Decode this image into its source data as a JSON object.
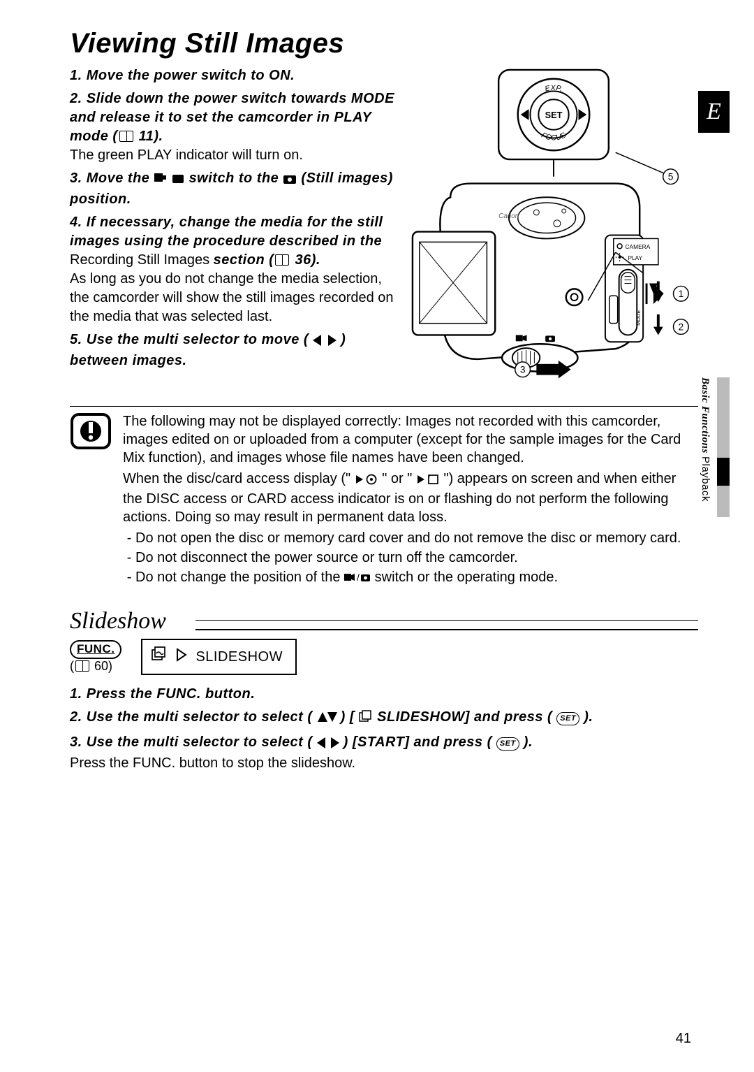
{
  "page": {
    "title": "Viewing Still Images",
    "number": "41",
    "lang_tab": "E",
    "side_section": "Basic Functions",
    "side_sub": "Playback"
  },
  "steps": [
    {
      "n": "1",
      "lead": "Move the power switch to ON."
    },
    {
      "n": "2",
      "lead_a": "Slide down the power switch towards MODE and release it to set the camcorder in PLAY mode (",
      "lead_b": "11).",
      "plain": "The green PLAY indicator will turn on."
    },
    {
      "n": "3",
      "lead_a": "Move the ",
      "lead_b": " switch to the ",
      "lead_c": " (Still images) position."
    },
    {
      "n": "4",
      "lead_a": "If necessary, change the media for the still images using the procedure described in the ",
      "link": "Recording Still Images",
      "lead_b": " section (",
      "lead_c": "36).",
      "plain": "As long as you do not change the media selection, the camcorder will show the still images recorded on the media that was selected last."
    },
    {
      "n": "5",
      "lead_a": "Use the multi selector to move (",
      "lead_b": ") between images."
    }
  ],
  "caution": {
    "p1a": "The following may not be displayed correctly: Images not recorded with this camcorder, images edited on or uploaded from a computer (except for the sample images for the Card Mix function), and images whose file names have been changed.",
    "p2a": "When the disc/card access display (\"",
    "p2b": "\" or \"",
    "p2c": "\") appears on screen and when either the DISC access or CARD access indicator is on or flashing do not perform the following actions. Doing so may result in permanent data loss.",
    "li1": "Do not open the disc or memory card cover and do not remove the disc or memory card.",
    "li2": "Do not disconnect the power source or turn off the camcorder.",
    "li3a": "Do not change the position of the ",
    "li3b": " switch or the operating mode."
  },
  "slideshow": {
    "heading": "Slideshow",
    "func_label": "FUNC.",
    "func_ref": "60",
    "box_label": "SLIDESHOW",
    "steps": [
      {
        "n": "1",
        "lead": "Press the FUNC. button."
      },
      {
        "n": "2",
        "lead_a": "Use the multi selector to select (",
        "lead_b": ") [",
        "lead_c": " SLIDESHOW] and press (",
        "lead_d": ")."
      },
      {
        "n": "3",
        "lead_a": "Use the multi selector to select (",
        "lead_b": ") [START] and press (",
        "lead_c": ").",
        "plain": "Press the FUNC. button to stop the slideshow."
      }
    ]
  },
  "illustration": {
    "labels": {
      "exp": "EXP.",
      "set": "SET",
      "focus": "FOCUS",
      "camera": "CAMERA",
      "play": "PLAY",
      "mode": "MODE"
    }
  }
}
